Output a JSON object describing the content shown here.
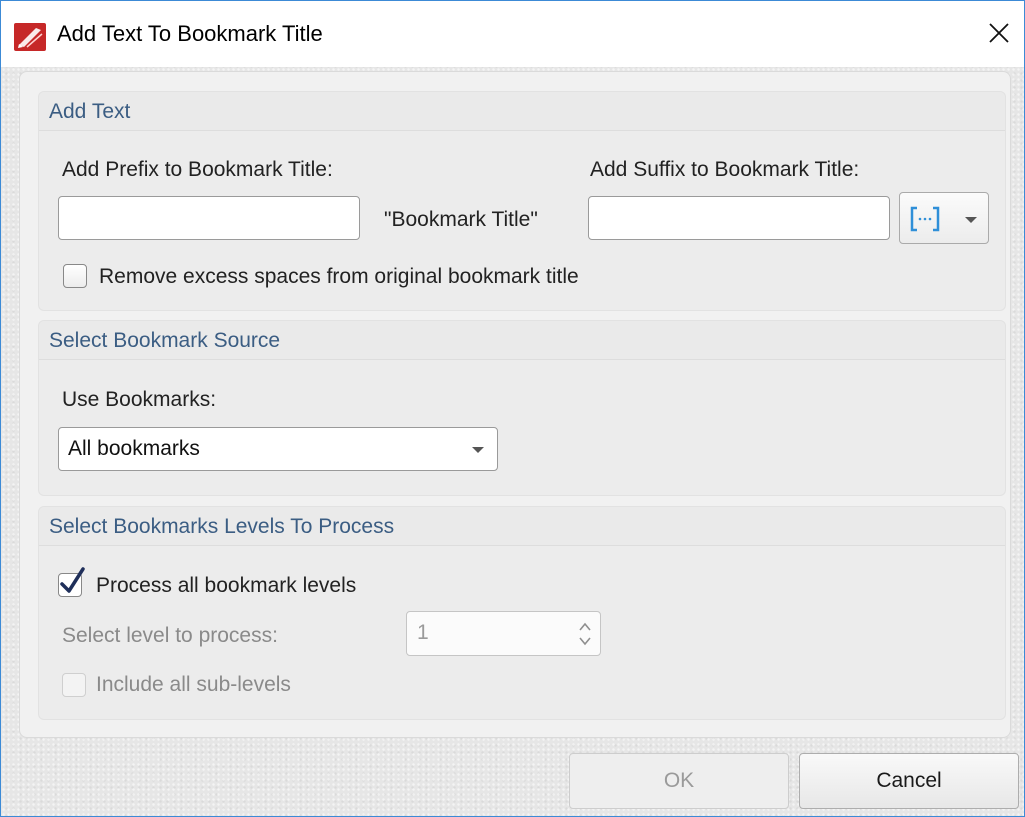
{
  "window": {
    "title": "Add Text To Bookmark Title",
    "close_glyph": "✕"
  },
  "add_text": {
    "group_title": "Add Text",
    "prefix_label": "Add Prefix to Bookmark Title:",
    "prefix_value": "",
    "middle_text": "\"Bookmark Title\"",
    "suffix_label": "Add Suffix to Bookmark Title:",
    "suffix_value": "",
    "macro_icon": "macro-insert-icon",
    "remove_spaces_label": "Remove excess spaces from original bookmark title",
    "remove_spaces_checked": false
  },
  "source": {
    "group_title": "Select Bookmark Source",
    "use_label": "Use Bookmarks:",
    "selected": "All bookmarks"
  },
  "levels": {
    "group_title": "Select Bookmarks Levels To Process",
    "process_all_label": "Process all bookmark levels",
    "process_all_checked": true,
    "level_label": "Select level to process:",
    "level_value": "1",
    "sub_levels_label": "Include all sub-levels",
    "sub_levels_checked": false
  },
  "buttons": {
    "ok_mnemonic": "O",
    "ok_rest": "K",
    "cancel_mnemonic": "C",
    "cancel_rest": "ancel"
  },
  "colors": {
    "accent": "#3c8ad6",
    "group_title": "#3b5d83",
    "icon_red": "#c62828"
  }
}
